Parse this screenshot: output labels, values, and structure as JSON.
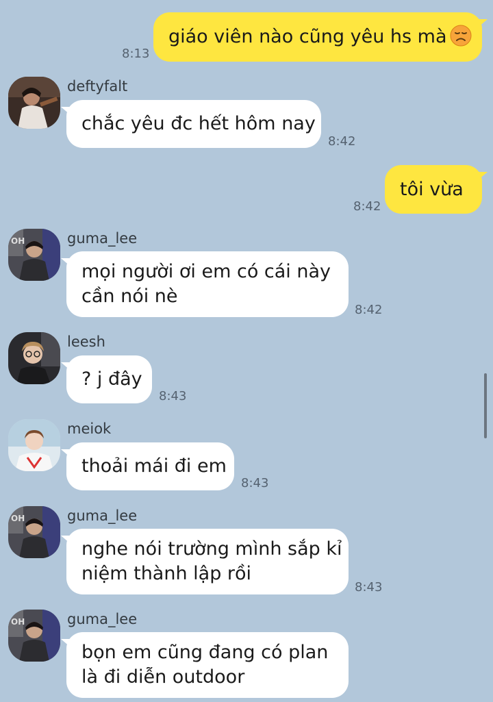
{
  "messages": [
    {
      "type": "out",
      "lines": [
        "giáo viên nào cũng yêu hs mà"
      ],
      "emoji": "disappointed-face-icon",
      "time": "8:13"
    },
    {
      "type": "in",
      "sender": "deftyfalt",
      "avatar": "avatar-deftyfalt",
      "lines": [
        "chắc yêu đc hết hôm nay"
      ],
      "time": "8:42"
    },
    {
      "type": "out",
      "lines": [
        "tôi vừa"
      ],
      "time": "8:42"
    },
    {
      "type": "in",
      "sender": "guma_lee",
      "avatar": "avatar-guma_lee",
      "lines": [
        "mọi người ơi em có cái này",
        "cần nói nè"
      ],
      "time": "8:42"
    },
    {
      "type": "in",
      "sender": "leesh",
      "avatar": "avatar-leesh",
      "lines": [
        "? j đây"
      ],
      "time": "8:43"
    },
    {
      "type": "in",
      "sender": "meiok",
      "avatar": "avatar-meiok",
      "lines": [
        "thoải mái đi em"
      ],
      "time": "8:43"
    },
    {
      "type": "in",
      "sender": "guma_lee",
      "avatar": "avatar-guma_lee",
      "lines": [
        "nghe nói trường mình sắp kỉ",
        "niệm thành lập rồi"
      ],
      "time": "8:43"
    },
    {
      "type": "in",
      "sender": "guma_lee",
      "avatar": "avatar-guma_lee",
      "lines": [
        "bọn em cũng đang có plan",
        "là đi diễn outdoor"
      ],
      "time": ""
    }
  ],
  "colors": {
    "background": "#b2c7da",
    "outgoing_bubble": "#fee640",
    "incoming_bubble": "#ffffff"
  }
}
